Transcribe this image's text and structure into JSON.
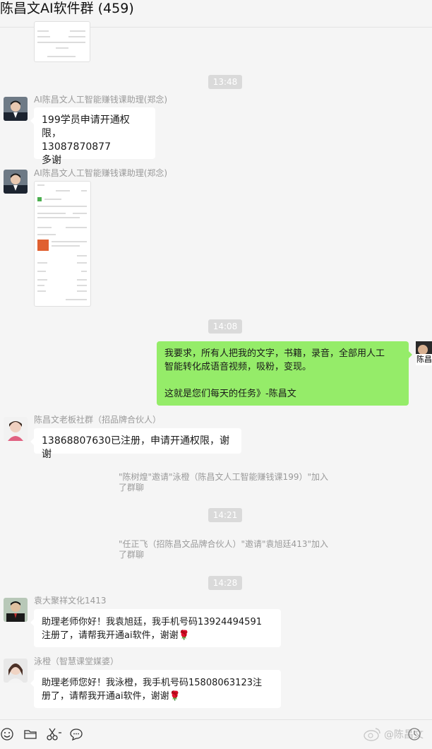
{
  "window": {
    "title": "陈昌文AI软件群 (459)"
  },
  "timestamps": [
    "13:48",
    "14:08",
    "14:21",
    "14:28"
  ],
  "messages": {
    "m1": {
      "sender": "AI陈昌文人工智能赚钱课助理(郑念)",
      "text": "199学员申请开通权限，\n13087870877\n多谢"
    },
    "m2": {
      "sender": "AI陈昌文人工智能赚钱课助理(郑念)"
    },
    "m3": {
      "text": "我要求，所有人把我的文字，书籍，录音，全部用人工\n智能转化成语音视频，吸粉，变现。\n\n这就是您们每天的任务》-陈昌文",
      "avatar_label": "陈昌"
    },
    "m4": {
      "sender": "陈昌文老板社群（招品牌合伙人）",
      "text": "13868807630已注册，申请开通权限，谢谢"
    },
    "m5": {
      "sender": "袁大聚祥文化1413",
      "text": "助理老师你好！我袁旭廷，我手机号码13924494591\n注册了，请帮我开通ai软件，谢谢🌹"
    },
    "m6": {
      "sender": "泳橙（智慧课堂媒婆）",
      "text": "助理老师您好！我泳橙，我手机号码15808063123注\n册了，请帮我开通ai软件，谢谢🌹"
    }
  },
  "system": {
    "s1": "\"陈树煌\"邀请\"泳橙（陈昌文人工智能赚钱课199）\"加入\n了群聊",
    "s2": "\"任正飞（招陈昌文品牌合伙人）\"邀请\"袁旭廷413\"加入\n了群聊"
  },
  "toolbar": {
    "icons": [
      "emoji-icon",
      "folder-icon",
      "scissors-icon",
      "chat-bubble-icon"
    ]
  },
  "watermark": "@陈昌文",
  "colors": {
    "self_bubble": "#95ec69",
    "other_bubble": "#ffffff",
    "background": "#f5f5f5"
  }
}
